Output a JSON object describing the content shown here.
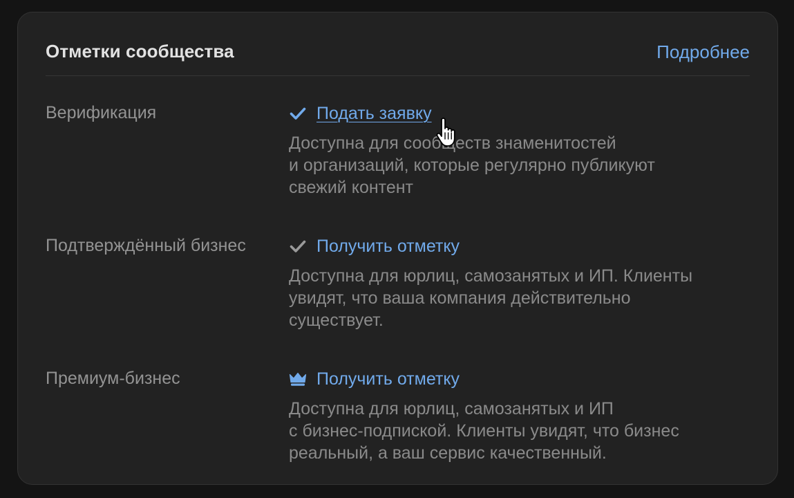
{
  "header": {
    "title": "Отметки сообщества",
    "more_link": "Подробнее"
  },
  "rows": [
    {
      "label": "Верификация",
      "action": "Подать заявку",
      "icon": "checkmark-icon",
      "icon_color": "#71aaeb",
      "desc_lines": [
        "Доступна для сообществ знаменитостей",
        "и организаций, которые регулярно публикуют",
        "свежий контент"
      ]
    },
    {
      "label": "Подтверждённый бизнес",
      "action": "Получить отметку",
      "icon": "checkmark-icon",
      "icon_color": "#9a9a9a",
      "desc_lines": [
        "Доступна для юрлиц, самозанятых и ИП. Клиенты",
        "увидят, что ваша компания действительно",
        "существует."
      ]
    },
    {
      "label": "Премиум-бизнес",
      "action": "Получить отметку",
      "icon": "crown-icon",
      "icon_color": "#71aaeb",
      "desc_lines": [
        "Доступна для юрлиц, самозанятых и ИП",
        "с бизнес-подпиской. Клиенты увидят, что бизнес",
        "реальный, а ваш сервис качественный."
      ]
    }
  ],
  "colors": {
    "background": "#141414",
    "card": "#222222",
    "accent": "#71aaeb",
    "title": "#e2e2e2",
    "muted": "#8a8a8a"
  }
}
